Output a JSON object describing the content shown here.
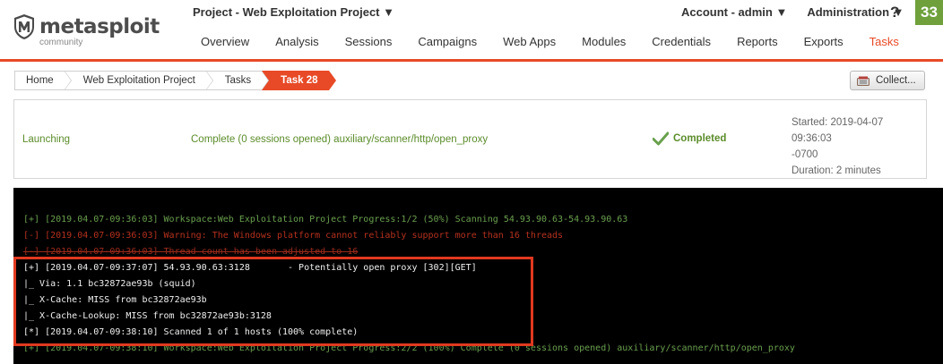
{
  "brand": {
    "name": "metasploit",
    "edition": "community"
  },
  "header": {
    "project_selector": "Project - Web Exploitation Project ▼",
    "account_menu": "Account - admin ▼",
    "admin_menu": "Administration ▼",
    "help": "?",
    "badge": "33",
    "badge_color": "#6fa03c",
    "accent_color": "#e84a27"
  },
  "nav": {
    "tabs": [
      {
        "label": "Overview"
      },
      {
        "label": "Analysis"
      },
      {
        "label": "Sessions"
      },
      {
        "label": "Campaigns"
      },
      {
        "label": "Web Apps"
      },
      {
        "label": "Modules"
      },
      {
        "label": "Credentials"
      },
      {
        "label": "Reports"
      },
      {
        "label": "Exports"
      },
      {
        "label": "Tasks",
        "active": true
      }
    ]
  },
  "breadcrumb": {
    "items": [
      "Home",
      "Web Exploitation Project",
      "Tasks",
      "Task 28"
    ]
  },
  "actions": {
    "collect_label": "Collect..."
  },
  "task": {
    "state": "Launching",
    "description": "Complete (0 sessions opened) auxiliary/scanner/http/open_proxy",
    "status": "Completed",
    "started": "Started: 2019-04-07 09:36:03",
    "timezone": "-0700",
    "duration": "Duration: 2 minutes"
  },
  "console": {
    "lines": [
      {
        "text": "[+] [2019.04.07-09:36:03] Workspace:Web Exploitation Project Progress:1/2 (50%) Scanning 54.93.90.63-54.93.90.63",
        "color": "green"
      },
      {
        "text": "[-] [2019.04.07-09:36:03] Warning: The Windows platform cannot reliably support more than 16 threads",
        "color": "red"
      },
      {
        "text": "[-] [2019.04.07-09:36:03] Thread count has been adjusted to 16",
        "color": "red"
      },
      {
        "text": "[+] [2019.04.07-09:37:07] 54.93.90.63:3128       - Potentially open proxy [302][GET]",
        "color": "white"
      },
      {
        "text": "|_ Via: 1.1 bc32872ae93b (squid)",
        "color": "white"
      },
      {
        "text": "|_ X-Cache: MISS from bc32872ae93b",
        "color": "white"
      },
      {
        "text": "|_ X-Cache-Lookup: MISS from bc32872ae93b:3128",
        "color": "white"
      },
      {
        "text": "[*] [2019.04.07-09:38:10] Scanned 1 of 1 hosts (100% complete)",
        "color": "white"
      },
      {
        "text": "[+] [2019.04.07-09:38:10] Workspace:Web Exploitation Project Progress:2/2 (100%) Complete (0 sessions opened) auxiliary/scanner/http/open_proxy",
        "color": "green"
      }
    ]
  }
}
